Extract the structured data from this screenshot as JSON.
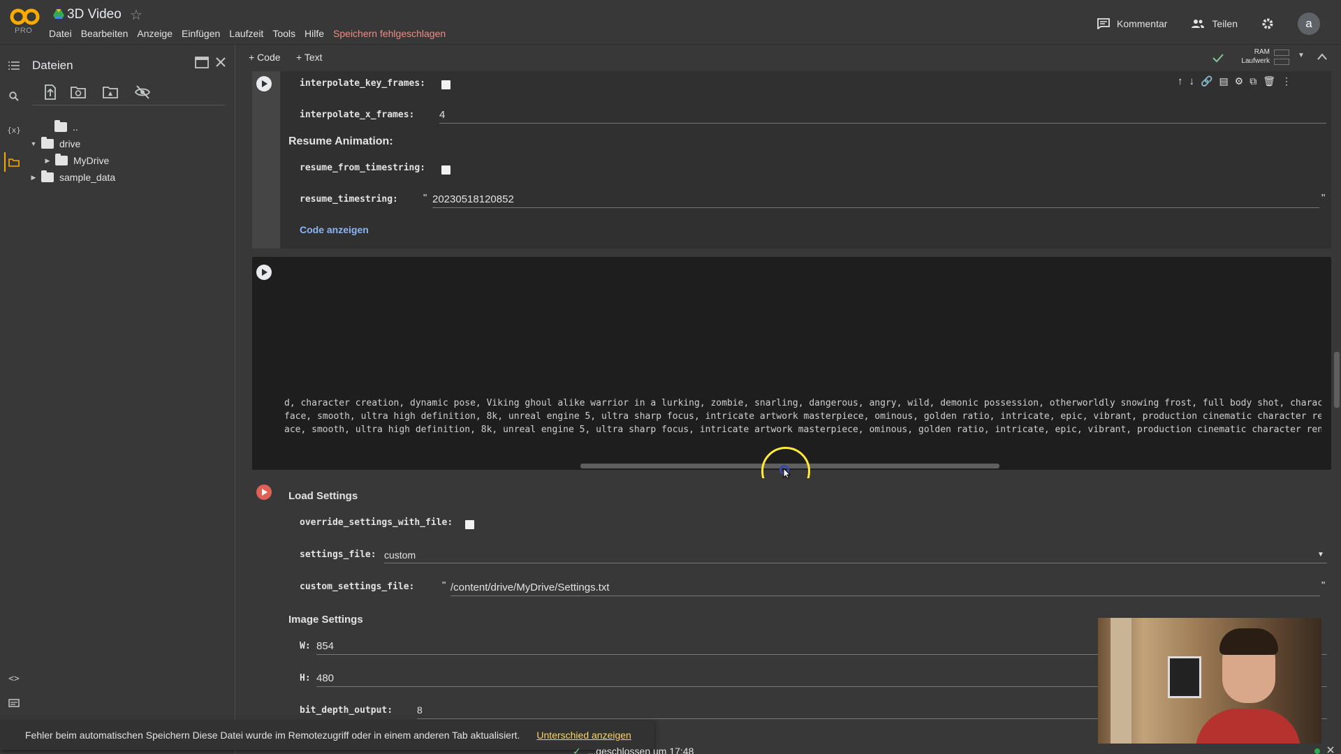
{
  "header": {
    "title": "3D Video",
    "pro_label": "PRO",
    "menu": [
      "Datei",
      "Bearbeiten",
      "Anzeige",
      "Einfügen",
      "Laufzeit",
      "Tools",
      "Hilfe"
    ],
    "save_error": "Speichern fehlgeschlagen",
    "comment_label": "Kommentar",
    "share_label": "Teilen",
    "avatar_letter": "a"
  },
  "files_panel": {
    "title": "Dateien",
    "tree": [
      {
        "label": "..",
        "depth": 0
      },
      {
        "label": "drive",
        "depth": 0
      },
      {
        "label": "MyDrive",
        "depth": 1
      },
      {
        "label": "sample_data",
        "depth": 0
      }
    ]
  },
  "toolbar": {
    "add_code": "+ Code",
    "add_text": "+ Text",
    "ram_label": "RAM",
    "disk_label": "Laufwerk"
  },
  "cell1": {
    "interpolate_key_frames_label": "interpolate_key_frames:",
    "interpolate_x_frames_label": "interpolate_x_frames:",
    "interpolate_x_frames_value": "4",
    "resume_heading": "Resume Animation:",
    "resume_from_timestring_label": "resume_from_timestring:",
    "resume_timestring_label": "resume_timestring:",
    "resume_timestring_value": "20230518120852",
    "quote": "\"",
    "show_code": "Code anzeigen"
  },
  "cell2": {
    "output_lines": [
      "d, character creation, dynamic pose, Viking ghoul alike warrior in a lurking, zombie, snarling, dangerous, angry, wild, demonic possession, otherworldly snowing frost, full body shot, character",
      "face, smooth, ultra high definition, 8k, unreal engine 5, ultra sharp focus, intricate artwork masterpiece, ominous, golden ratio, intricate, epic, vibrant, production cinematic character render",
      "ace, smooth, ultra high definition, 8k, unreal engine 5, ultra sharp focus, intricate artwork masterpiece, ominous, golden ratio, intricate, epic, vibrant, production cinematic character render"
    ]
  },
  "cell3": {
    "title": "Load Settings",
    "override_label": "override_settings_with_file:",
    "settings_file_label": "settings_file:",
    "settings_file_value": "custom",
    "custom_settings_label": "custom_settings_file:",
    "custom_settings_value": "/content/drive/MyDrive/Settings.txt",
    "image_settings_heading": "Image Settings",
    "w_label": "W:",
    "w_value": "854",
    "h_label": "H:",
    "h_value": "480",
    "bit_depth_label": "bit_depth_output:",
    "bit_depth_value": "8"
  },
  "toast": {
    "message": "Fehler beim automatischen Speichern Diese Datei wurde im Remotezugriff oder in einem anderen Tab aktualisiert.",
    "action": "Unterschied anzeigen"
  },
  "status": {
    "text": "...geschlossen um 17:48"
  },
  "colors": {
    "accent_orange": "#f9ab00",
    "error_red": "#f28b82",
    "link_blue": "#8ab4f8",
    "toast_link": "#fdd663",
    "cursor_ring": "#ffeb3b"
  }
}
